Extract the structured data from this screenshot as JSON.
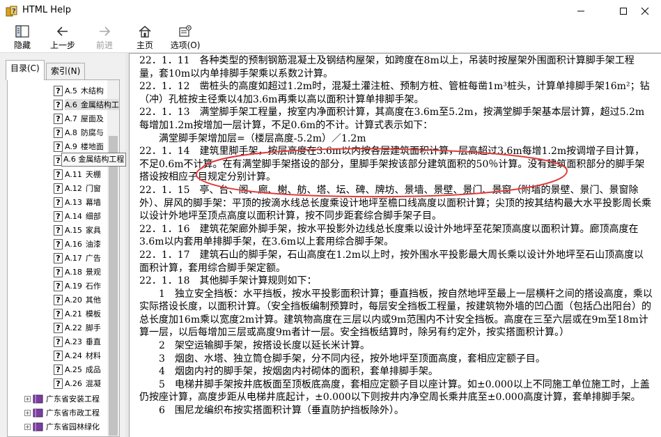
{
  "window": {
    "title": "HTML Help"
  },
  "toolbar": {
    "hide_label": "隐藏",
    "back_label": "上一步",
    "forward_label": "前进",
    "home_label": "主页",
    "options_label": "选项(O)"
  },
  "nav": {
    "tab_contents": "目录(C)",
    "tab_index": "索引(N)",
    "tooltip": "A.6  金属结构工程",
    "items": [
      {
        "code": "A.5",
        "name": "木结构"
      },
      {
        "code": "A.6",
        "name": "金属结构工程"
      },
      {
        "code": "A.7",
        "name": "屋面及"
      },
      {
        "code": "A.8",
        "name": "防腐与"
      },
      {
        "code": "A.9",
        "name": "楼地面"
      },
      {
        "code": "A.10",
        "name": "墙柱"
      },
      {
        "code": "A.11",
        "name": "天棚"
      },
      {
        "code": "A.12",
        "name": "门窗"
      },
      {
        "code": "A.13",
        "name": "幕墙"
      },
      {
        "code": "A.14",
        "name": "细部"
      },
      {
        "code": "A.15",
        "name": "家具"
      },
      {
        "code": "A.16",
        "name": "油漆"
      },
      {
        "code": "A.17",
        "name": "广告"
      },
      {
        "code": "A.18",
        "name": "景观"
      },
      {
        "code": "A.19",
        "name": "石作"
      },
      {
        "code": "A.20",
        "name": "其他"
      },
      {
        "code": "A.21",
        "name": "模板"
      },
      {
        "code": "A.22",
        "name": "脚手"
      },
      {
        "code": "A.23",
        "name": "垂直"
      },
      {
        "code": "A.24",
        "name": "材料"
      },
      {
        "code": "A.25",
        "name": "成品"
      },
      {
        "code": "A.26",
        "name": "混凝"
      }
    ],
    "books": [
      {
        "name": "广东省安装工程"
      },
      {
        "name": "广东省市政工程"
      },
      {
        "name": "广东省园林绿化"
      }
    ]
  },
  "content": {
    "paragraphs": [
      "22．1．11　各种类型的预制钢筋混凝土及钢结构屋架，如跨度在8m以上，吊装时按屋架外围面积计算脚手架工程量，套10m以内单排脚手架乘以系数2计算。",
      "22．1．12　凿桩头的高度如超过1.2m时，混凝土灌注桩、预制方桩、管桩每凿1m³桩头，计算单排脚手架16m²；钻（冲）孔桩按主径乘以4加3.6m再乘以高以面积计算单排脚手架。",
      "22．1．13　满堂脚手架工程量，按室内净面积计算，其高度在3.6m至5.2m，按满堂脚手架基本层计算，超过5.2m每增加1.2m按增加一层计算，不足0.6m的不计。计算式表示如下：",
      "　　满堂脚手架增加层=（楼层高度-5.2m）／1.2m",
      "22．1．14　建筑里脚手架，按层高度在3.6m以内按各层建筑面积计算，层高超过3.6m每增1.2m按调增子目计算，不足0.6m不计算。在有满堂脚手架搭设的部分，里脚手架按该部分建筑面积的50％计算。没有建筑面积部分的脚手架搭设按相应子目规定分别计算。",
      "22．1．15　亭、台、阁、廊、榭、舫、塔、坛、碑、牌坊、景墙、景壁、景门、景窗（附墙的景壁、景门、景窗除外）、屏风的脚手架：平顶的按滴水线总长度乘设计地坪至檐口线高度以面积计算；尖顶的按其结构最大水平投影周长乘以设计外地坪至顶点高度以面积计算，按不同步距套综合脚手架子目。",
      "22．1．16　建筑花架廊外脚手架，按水平投影外边线总长度乘以设计外地坪至花架顶高度以面积计算。廊顶高度在3.6m以内套用单排脚手架，在3.6m以上套用综合脚手架。",
      "22．1．17　建筑石山的脚手架，石山高度在1.2m以上时，按外围水平投影最大周长乘以设计外地坪至石山顶高度以面积计算，套用综合脚手架定额。",
      "22．1．18　其他脚手架计算规则如下：",
      "　　1　独立安全挡板：水平挡板，按水平投影面积计算；垂直挡板，按自然地坪至最上一层横杆之间的搭设高度，乘以实际搭设长度，以面积计算。（安全挡板编制预算时，每层安全挡板工程量，按建筑物外墙的凹凸面（包括凸出阳台）的总长度加16m乘以宽度2m计算。建筑物高度在三层以内或9m范围内不计安全挡板。高度在三至六层或在9m至18m计算一层，以后每增加三层或高度9m者计一层。安全挡板结算时，除另有约定外，按实搭面积计算。）",
      "　　2　架空运输脚手架，按搭设长度以延长米计算。",
      "　　3　烟囱、水塔、独立筒仓脚手架，分不同内径，按外地坪至顶面高度，套相应定额子目。",
      "　　4　烟囱内衬的脚手架，按烟囱内衬砌体的面积，套单排脚手架。",
      "　　5　电梯井脚手架按井底板面至顶板底高度，套相应定额子目以座计算。如±0.000以上不同施工单位施工时，上盖仍按座计算，高度步距从电梯井底起计，±0.000以下则按井内净空周长乘井底至±0.000高度计算，套单排脚手架。",
      "　　6　围尼龙编织布按实搭面积计算（垂直防护挡板除外）。"
    ]
  },
  "colors": {
    "annotation": "#e03c3c",
    "selection": "#e0e0e0"
  }
}
